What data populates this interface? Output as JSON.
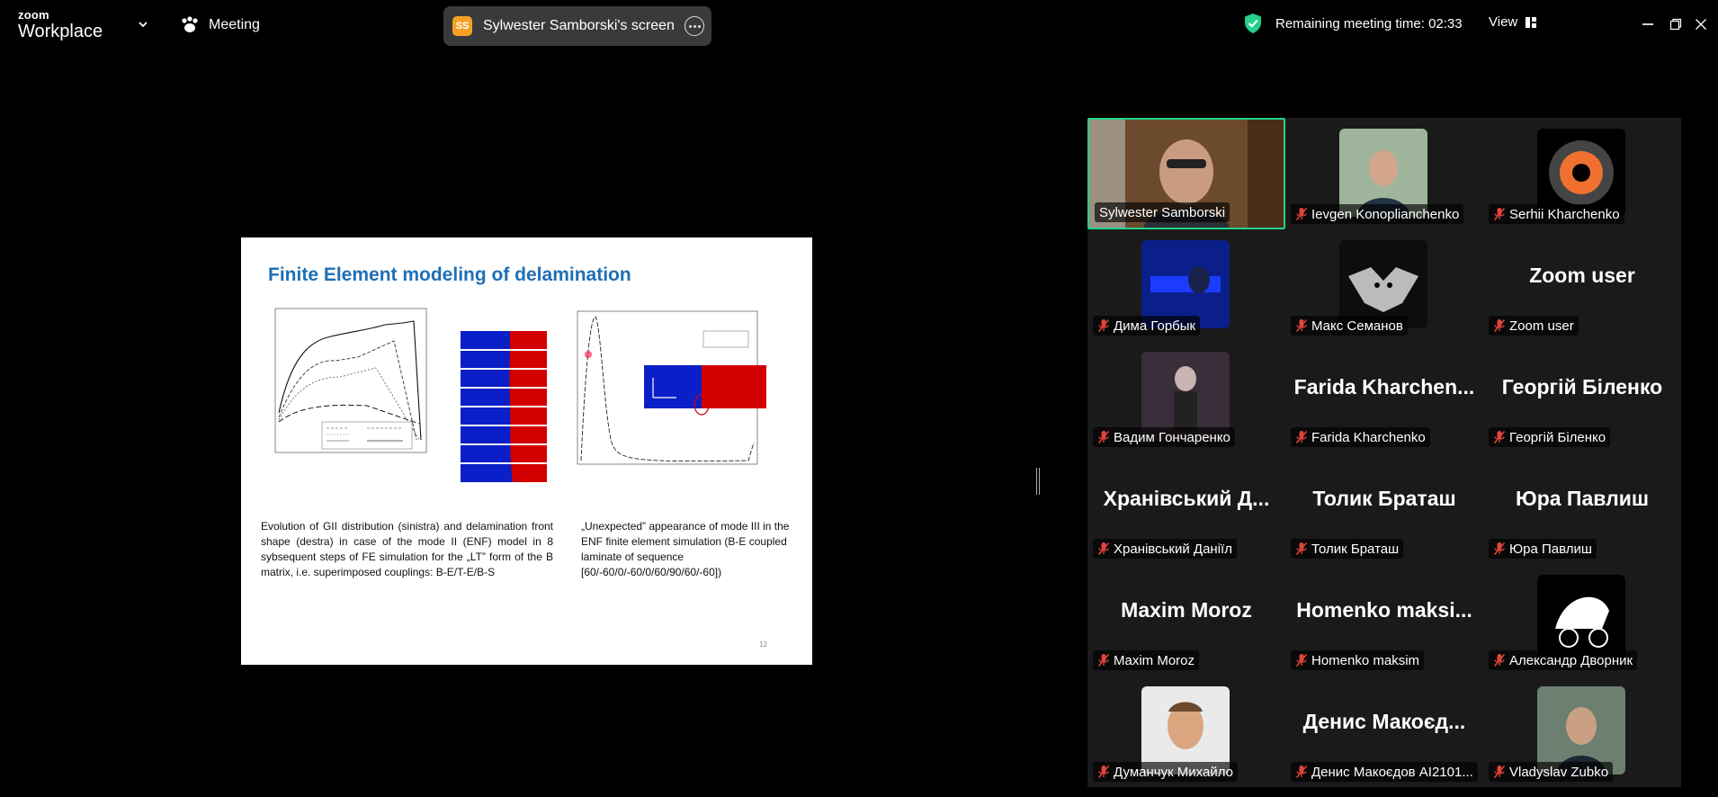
{
  "app": {
    "logo_line1": "zoom",
    "logo_line2": "Workplace",
    "meeting_label": "Meeting",
    "share_initials": "SS",
    "share_title": "Sylwester Samborski's screen",
    "remaining_time": "Remaining meeting time: 02:33",
    "view_label": "View"
  },
  "colors": {
    "accent_active": "#23d18b",
    "muted_red": "#e0453a",
    "slide_title": "#1f6fb5",
    "share_avatar": "#f4a124"
  },
  "icons": {
    "chevron": "chevron-down-icon",
    "meeting": "paw-icon",
    "more": "more-icon",
    "shield": "shield-check-icon",
    "view": "grid-icon",
    "minimize": "minimize-icon",
    "restore": "restore-icon",
    "close": "close-icon",
    "mic_muted": "mic-muted-icon"
  },
  "slide": {
    "title": "Finite Element modeling of delamination",
    "caption_left": "Evolution of GII distribution (sinistra) and delamination front shape (destra) in case of the mode II (ENF) model in 8 sybsequent steps of FE simulation for the „LT” form of the B matrix, i.e. superimposed couplings: B-E/T-E/B-S",
    "caption_right": "„Unexpected” appearance of mode III in the ENF finite element simulation (B-E coupled laminate of sequence [60/-60/0/-60/0/60/90/60/-60])",
    "page": "12"
  },
  "participants": [
    {
      "name": "Sylwester Samborski",
      "display": "",
      "muted": false,
      "active": true,
      "photo": "video"
    },
    {
      "name": "Ievgen Konoplianchenko",
      "display": "",
      "muted": true,
      "active": false,
      "photo": "man-green"
    },
    {
      "name": "Serhii Kharchenko",
      "display": "",
      "muted": true,
      "active": false,
      "photo": "gear-logo"
    },
    {
      "name": "Дима Горбык",
      "display": "",
      "muted": true,
      "active": false,
      "photo": "blue-neon"
    },
    {
      "name": "Макс Семанов",
      "display": "",
      "muted": true,
      "active": false,
      "photo": "bat"
    },
    {
      "name": "Zoom user",
      "display": "Zoom user",
      "muted": true,
      "active": false,
      "photo": ""
    },
    {
      "name": "Вадим Гончаренко",
      "display": "",
      "muted": true,
      "active": false,
      "photo": "dark-man"
    },
    {
      "name": "Farida Kharchenko",
      "display": "Farida Kharchen...",
      "muted": true,
      "active": false,
      "photo": ""
    },
    {
      "name": "Георгій Біленко",
      "display": "Георгій Біленко",
      "muted": true,
      "active": false,
      "photo": ""
    },
    {
      "name": "Хранівський Даніїл",
      "display": "Хранівський Д...",
      "muted": true,
      "active": false,
      "photo": ""
    },
    {
      "name": "Толик Браташ",
      "display": "Толик Браташ",
      "muted": true,
      "active": false,
      "photo": ""
    },
    {
      "name": "Юра Павлиш",
      "display": "Юра Павлиш",
      "muted": true,
      "active": false,
      "photo": ""
    },
    {
      "name": "Maxim Moroz",
      "display": "Maxim Moroz",
      "muted": true,
      "active": false,
      "photo": ""
    },
    {
      "name": "Homenko maksim",
      "display": "Homenko maksi...",
      "muted": true,
      "active": false,
      "photo": ""
    },
    {
      "name": "Александр Дворник",
      "display": "",
      "muted": true,
      "active": false,
      "photo": "biker-logo"
    },
    {
      "name": "Думанчук Михайло",
      "display": "",
      "muted": true,
      "active": false,
      "photo": "man-white"
    },
    {
      "name": "Денис Макоєдов АІ2101...",
      "display": "Денис Макоєд...",
      "muted": true,
      "active": false,
      "photo": ""
    },
    {
      "name": "Vladyslav Zubko",
      "display": "",
      "muted": true,
      "active": false,
      "photo": "man-outdoor"
    }
  ]
}
